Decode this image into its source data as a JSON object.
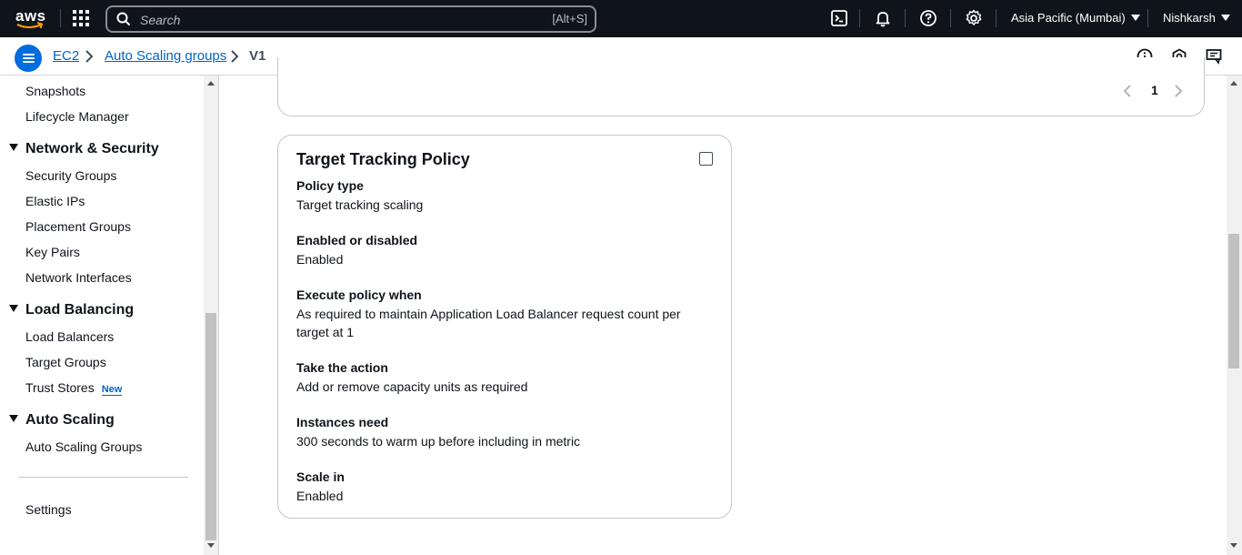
{
  "topnav": {
    "logo_text": "aws",
    "search": {
      "placeholder": "Search",
      "shortcut": "[Alt+S]"
    },
    "icons": [
      "cloudshell-icon",
      "bell-icon",
      "help-icon",
      "gear-icon"
    ],
    "region": "Asia Pacific (Mumbai)",
    "user": "Nishkarsh"
  },
  "breadcrumb": {
    "items": [
      {
        "label": "EC2",
        "link": true
      },
      {
        "label": "Auto Scaling groups",
        "link": true
      },
      {
        "label": "V1",
        "link": false
      }
    ],
    "utility_icons": [
      "info-icon",
      "notifications-settings-icon",
      "feedback-icon"
    ]
  },
  "sidebar": {
    "top_items": [
      "Snapshots",
      "Lifecycle Manager"
    ],
    "sections": [
      {
        "title": "Network & Security",
        "items": [
          "Security Groups",
          "Elastic IPs",
          "Placement Groups",
          "Key Pairs",
          "Network Interfaces"
        ]
      },
      {
        "title": "Load Balancing",
        "items": [
          "Load Balancers",
          "Target Groups",
          "Trust Stores"
        ],
        "new_badge": "New"
      },
      {
        "title": "Auto Scaling",
        "items": [
          "Auto Scaling Groups"
        ]
      }
    ],
    "settings": "Settings"
  },
  "pager": {
    "current_page": "1"
  },
  "policy_card": {
    "title": "Target Tracking Policy",
    "fields": [
      {
        "key": "Policy type",
        "value": "Target tracking scaling"
      },
      {
        "key": "Enabled or disabled",
        "value": "Enabled"
      },
      {
        "key": "Execute policy when",
        "value": "As required to maintain Application Load Balancer request count per target at 1"
      },
      {
        "key": "Take the action",
        "value": "Add or remove capacity units as required"
      },
      {
        "key": "Instances need",
        "value": "300 seconds to warm up before including in metric"
      },
      {
        "key": "Scale in",
        "value": "Enabled"
      }
    ]
  },
  "colors": {
    "nav_bg": "#0f141a",
    "link": "#0064c8",
    "accent": "#006ce0",
    "border": "#c6c6cd"
  }
}
